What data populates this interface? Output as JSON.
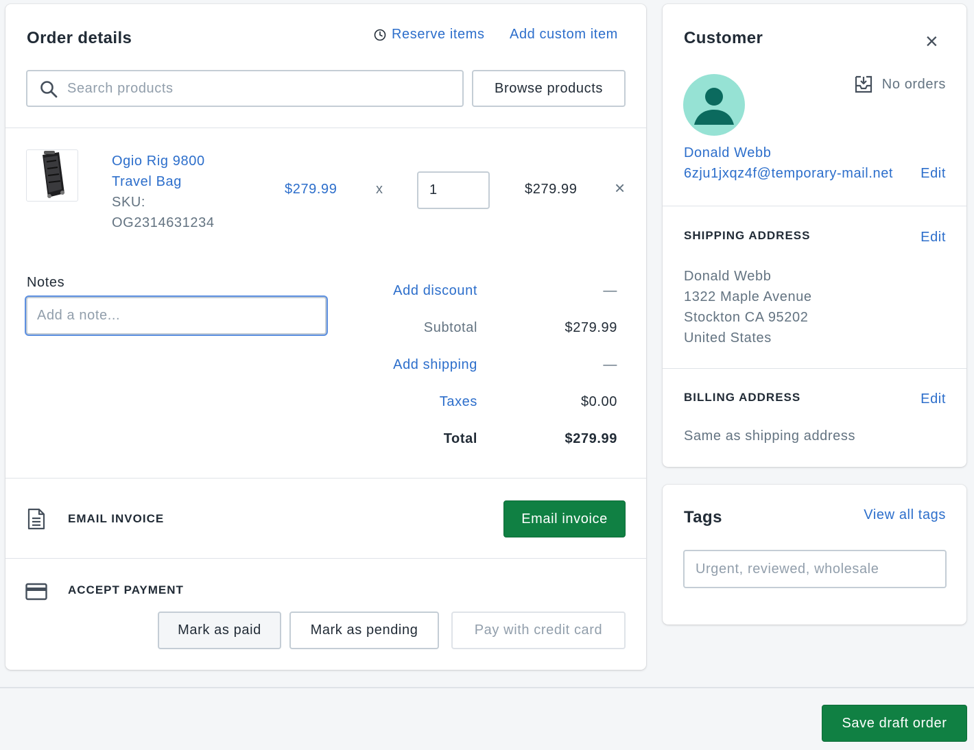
{
  "order": {
    "title": "Order details",
    "reserve_items": "Reserve items",
    "add_custom_item": "Add custom item",
    "search_placeholder": "Search products",
    "browse_products": "Browse products",
    "line_item": {
      "name_line1": "Ogio Rig 9800",
      "name_line2": "Travel Bag",
      "sku_label": "SKU:",
      "sku": "OG2314631234",
      "unit_price": "$279.99",
      "times": "x",
      "quantity": "1",
      "line_total": "$279.99",
      "remove": "×"
    },
    "notes": {
      "label": "Notes",
      "placeholder": "Add a note..."
    },
    "summary": {
      "add_discount": "Add discount",
      "discount_value": "—",
      "subtotal_label": "Subtotal",
      "subtotal_value": "$279.99",
      "add_shipping": "Add shipping",
      "shipping_value": "—",
      "taxes_label": "Taxes",
      "taxes_value": "$0.00",
      "total_label": "Total",
      "total_value": "$279.99"
    },
    "email_invoice": {
      "heading": "EMAIL INVOICE",
      "button": "Email invoice"
    },
    "accept_payment": {
      "heading": "ACCEPT PAYMENT",
      "mark_paid": "Mark as paid",
      "mark_pending": "Mark as pending",
      "pay_card": "Pay with credit card"
    }
  },
  "customer": {
    "title": "Customer",
    "close": "×",
    "orders": "No orders",
    "name": "Donald Webb",
    "email": "6zju1jxqz4f@temporary-mail.net",
    "edit": "Edit",
    "avatar_color": "#96e2d4",
    "avatar_fg": "#0b6a5e",
    "shipping": {
      "heading": "SHIPPING ADDRESS",
      "edit": "Edit",
      "line1": "Donald Webb",
      "line2": "1322 Maple Avenue",
      "line3": "Stockton CA 95202",
      "line4": "United States"
    },
    "billing": {
      "heading": "BILLING ADDRESS",
      "edit": "Edit",
      "text": "Same as shipping address"
    }
  },
  "tags": {
    "title": "Tags",
    "view_all": "View all tags",
    "placeholder": "Urgent, reviewed, wholesale"
  },
  "footer": {
    "save": "Save draft order"
  },
  "colors": {
    "link": "#2c6ecb",
    "primary": "#108043"
  }
}
